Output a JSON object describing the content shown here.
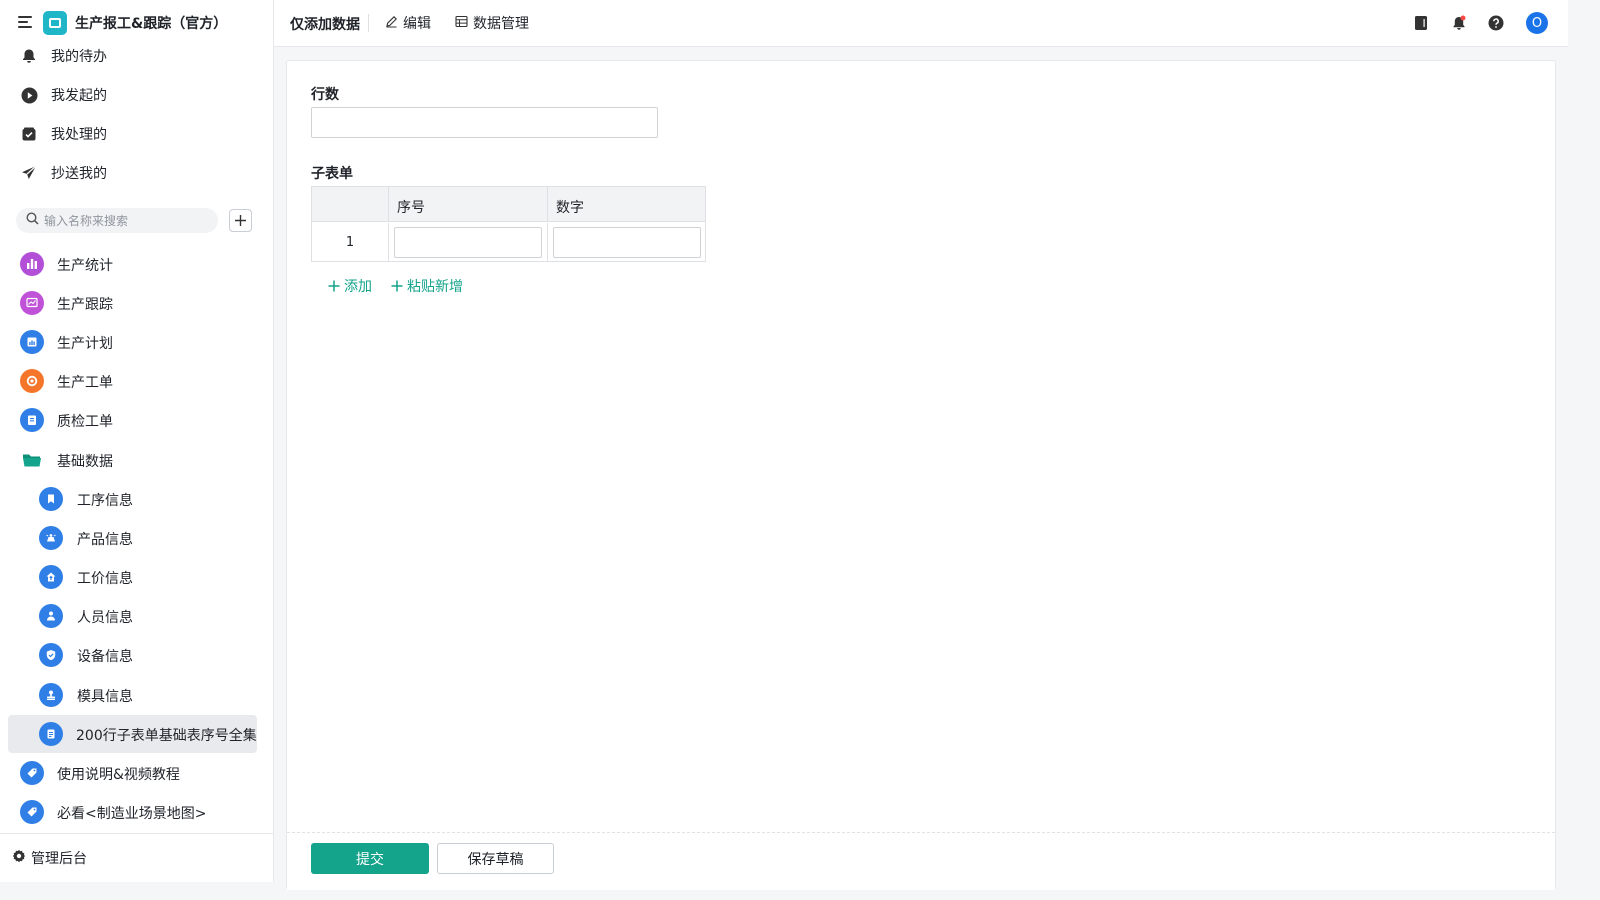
{
  "app": {
    "title": "生产报工&跟踪（官方）",
    "logo_color": "#1fb6c8"
  },
  "quick_nav": [
    {
      "label": "我的待办",
      "icon": "bell-icon"
    },
    {
      "label": "我发起的",
      "icon": "play-circle-icon"
    },
    {
      "label": "我处理的",
      "icon": "inbox-check-icon"
    },
    {
      "label": "抄送我的",
      "icon": "send-icon"
    }
  ],
  "search": {
    "placeholder": "输入名称来搜索"
  },
  "nav": [
    {
      "label": "生产统计",
      "icon": "bar-chart-icon",
      "color": "#b34fd6"
    },
    {
      "label": "生产跟踪",
      "icon": "trend-board-icon",
      "color": "#c052d8"
    },
    {
      "label": "生产计划",
      "icon": "calendar-chart-icon",
      "color": "#2f7fe6"
    },
    {
      "label": "生产工单",
      "icon": "target-icon",
      "color": "#f5762a"
    },
    {
      "label": "质检工单",
      "icon": "clipboard-icon",
      "color": "#2f7fe6"
    },
    {
      "label": "基础数据",
      "icon": "folder-open-icon",
      "color": "#14a38b"
    },
    {
      "label": "工序信息",
      "icon": "bookmark-icon",
      "color": "#2f7fe6"
    },
    {
      "label": "产品信息",
      "icon": "product-icon",
      "color": "#2f7fe6"
    },
    {
      "label": "工价信息",
      "icon": "upload-home-icon",
      "color": "#2f7fe6"
    },
    {
      "label": "人员信息",
      "icon": "person-icon",
      "color": "#2f7fe6"
    },
    {
      "label": "设备信息",
      "icon": "shield-check-icon",
      "color": "#2f7fe6"
    },
    {
      "label": "模具信息",
      "icon": "stamp-icon",
      "color": "#2f7fe6"
    },
    {
      "label": "200行子表单基础表序号全集",
      "icon": "document-icon",
      "color": "#2f7fe6"
    },
    {
      "label": "使用说明&视频教程",
      "icon": "tag-icon",
      "color": "#2f7fe6"
    },
    {
      "label": "必看<制造业场景地图>",
      "icon": "tag-icon",
      "color": "#2f7fe6"
    }
  ],
  "admin": {
    "label": "管理后台"
  },
  "topbar": {
    "title": "仅添加数据",
    "edit_label": "编辑",
    "data_manage_label": "数据管理",
    "avatar_letter": "O"
  },
  "form": {
    "rows_label": "行数",
    "rows_value": "",
    "subtable_label": "子表单",
    "columns": [
      "序号",
      "数字"
    ],
    "rows": [
      {
        "index": "1",
        "seq": "",
        "number": ""
      }
    ],
    "add_label": "添加",
    "paste_add_label": "粘贴新增",
    "submit_label": "提交",
    "save_draft_label": "保存草稿"
  },
  "colors": {
    "accent": "#14a38b",
    "active_bg": "#e8eaed",
    "avatar": "#1a73e8"
  }
}
